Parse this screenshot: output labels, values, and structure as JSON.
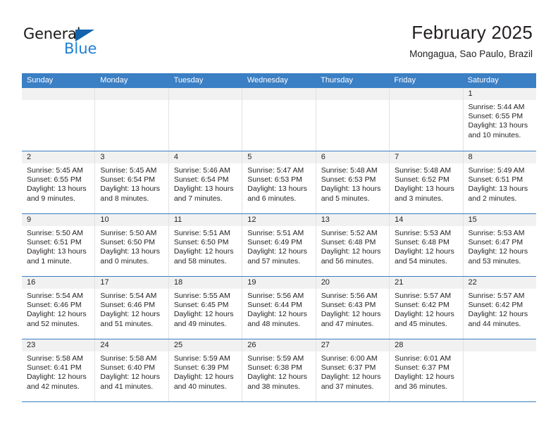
{
  "brand": {
    "name_dark": "General",
    "name_blue": "Blue",
    "color_blue": "#1f7fd4",
    "color_triangle": "#1363ad"
  },
  "header": {
    "title": "February 2025",
    "subtitle": "Mongagua, Sao Paulo, Brazil"
  },
  "theme": {
    "header_band": "#3b7fc4",
    "daynum_band": "#f1f1f1",
    "text": "#231f20"
  },
  "weekdays": [
    "Sunday",
    "Monday",
    "Tuesday",
    "Wednesday",
    "Thursday",
    "Friday",
    "Saturday"
  ],
  "weeks": [
    [
      {
        "day": "",
        "empty": true
      },
      {
        "day": "",
        "empty": true
      },
      {
        "day": "",
        "empty": true
      },
      {
        "day": "",
        "empty": true
      },
      {
        "day": "",
        "empty": true
      },
      {
        "day": "",
        "empty": true
      },
      {
        "day": "1",
        "sunrise": "Sunrise: 5:44 AM",
        "sunset": "Sunset: 6:55 PM",
        "daylight": "Daylight: 13 hours and 10 minutes."
      }
    ],
    [
      {
        "day": "2",
        "sunrise": "Sunrise: 5:45 AM",
        "sunset": "Sunset: 6:55 PM",
        "daylight": "Daylight: 13 hours and 9 minutes."
      },
      {
        "day": "3",
        "sunrise": "Sunrise: 5:45 AM",
        "sunset": "Sunset: 6:54 PM",
        "daylight": "Daylight: 13 hours and 8 minutes."
      },
      {
        "day": "4",
        "sunrise": "Sunrise: 5:46 AM",
        "sunset": "Sunset: 6:54 PM",
        "daylight": "Daylight: 13 hours and 7 minutes."
      },
      {
        "day": "5",
        "sunrise": "Sunrise: 5:47 AM",
        "sunset": "Sunset: 6:53 PM",
        "daylight": "Daylight: 13 hours and 6 minutes."
      },
      {
        "day": "6",
        "sunrise": "Sunrise: 5:48 AM",
        "sunset": "Sunset: 6:53 PM",
        "daylight": "Daylight: 13 hours and 5 minutes."
      },
      {
        "day": "7",
        "sunrise": "Sunrise: 5:48 AM",
        "sunset": "Sunset: 6:52 PM",
        "daylight": "Daylight: 13 hours and 3 minutes."
      },
      {
        "day": "8",
        "sunrise": "Sunrise: 5:49 AM",
        "sunset": "Sunset: 6:51 PM",
        "daylight": "Daylight: 13 hours and 2 minutes."
      }
    ],
    [
      {
        "day": "9",
        "sunrise": "Sunrise: 5:50 AM",
        "sunset": "Sunset: 6:51 PM",
        "daylight": "Daylight: 13 hours and 1 minute."
      },
      {
        "day": "10",
        "sunrise": "Sunrise: 5:50 AM",
        "sunset": "Sunset: 6:50 PM",
        "daylight": "Daylight: 13 hours and 0 minutes."
      },
      {
        "day": "11",
        "sunrise": "Sunrise: 5:51 AM",
        "sunset": "Sunset: 6:50 PM",
        "daylight": "Daylight: 12 hours and 58 minutes."
      },
      {
        "day": "12",
        "sunrise": "Sunrise: 5:51 AM",
        "sunset": "Sunset: 6:49 PM",
        "daylight": "Daylight: 12 hours and 57 minutes."
      },
      {
        "day": "13",
        "sunrise": "Sunrise: 5:52 AM",
        "sunset": "Sunset: 6:48 PM",
        "daylight": "Daylight: 12 hours and 56 minutes."
      },
      {
        "day": "14",
        "sunrise": "Sunrise: 5:53 AM",
        "sunset": "Sunset: 6:48 PM",
        "daylight": "Daylight: 12 hours and 54 minutes."
      },
      {
        "day": "15",
        "sunrise": "Sunrise: 5:53 AM",
        "sunset": "Sunset: 6:47 PM",
        "daylight": "Daylight: 12 hours and 53 minutes."
      }
    ],
    [
      {
        "day": "16",
        "sunrise": "Sunrise: 5:54 AM",
        "sunset": "Sunset: 6:46 PM",
        "daylight": "Daylight: 12 hours and 52 minutes."
      },
      {
        "day": "17",
        "sunrise": "Sunrise: 5:54 AM",
        "sunset": "Sunset: 6:46 PM",
        "daylight": "Daylight: 12 hours and 51 minutes."
      },
      {
        "day": "18",
        "sunrise": "Sunrise: 5:55 AM",
        "sunset": "Sunset: 6:45 PM",
        "daylight": "Daylight: 12 hours and 49 minutes."
      },
      {
        "day": "19",
        "sunrise": "Sunrise: 5:56 AM",
        "sunset": "Sunset: 6:44 PM",
        "daylight": "Daylight: 12 hours and 48 minutes."
      },
      {
        "day": "20",
        "sunrise": "Sunrise: 5:56 AM",
        "sunset": "Sunset: 6:43 PM",
        "daylight": "Daylight: 12 hours and 47 minutes."
      },
      {
        "day": "21",
        "sunrise": "Sunrise: 5:57 AM",
        "sunset": "Sunset: 6:42 PM",
        "daylight": "Daylight: 12 hours and 45 minutes."
      },
      {
        "day": "22",
        "sunrise": "Sunrise: 5:57 AM",
        "sunset": "Sunset: 6:42 PM",
        "daylight": "Daylight: 12 hours and 44 minutes."
      }
    ],
    [
      {
        "day": "23",
        "sunrise": "Sunrise: 5:58 AM",
        "sunset": "Sunset: 6:41 PM",
        "daylight": "Daylight: 12 hours and 42 minutes."
      },
      {
        "day": "24",
        "sunrise": "Sunrise: 5:58 AM",
        "sunset": "Sunset: 6:40 PM",
        "daylight": "Daylight: 12 hours and 41 minutes."
      },
      {
        "day": "25",
        "sunrise": "Sunrise: 5:59 AM",
        "sunset": "Sunset: 6:39 PM",
        "daylight": "Daylight: 12 hours and 40 minutes."
      },
      {
        "day": "26",
        "sunrise": "Sunrise: 5:59 AM",
        "sunset": "Sunset: 6:38 PM",
        "daylight": "Daylight: 12 hours and 38 minutes."
      },
      {
        "day": "27",
        "sunrise": "Sunrise: 6:00 AM",
        "sunset": "Sunset: 6:37 PM",
        "daylight": "Daylight: 12 hours and 37 minutes."
      },
      {
        "day": "28",
        "sunrise": "Sunrise: 6:01 AM",
        "sunset": "Sunset: 6:37 PM",
        "daylight": "Daylight: 12 hours and 36 minutes."
      },
      {
        "day": "",
        "empty": true
      }
    ]
  ]
}
